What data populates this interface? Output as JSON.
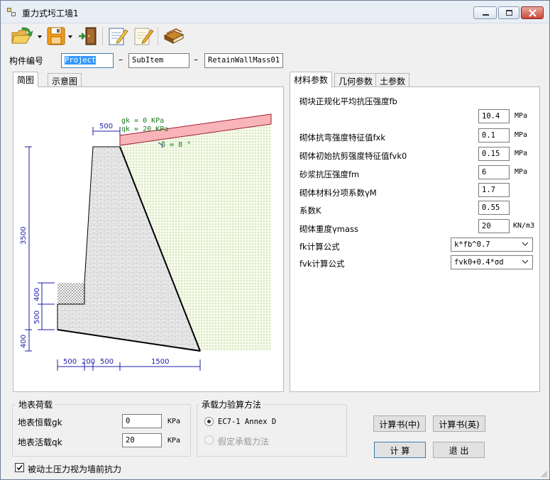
{
  "window": {
    "title": "重力式圬工墙1"
  },
  "toolbar": {
    "buttons": [
      {
        "name": "open-folder-icon"
      },
      {
        "name": "save-disk-icon"
      },
      {
        "name": "exit-door-icon"
      },
      {
        "name": "edit-note-icon"
      },
      {
        "name": "edit-pencil-icon"
      },
      {
        "name": "book-icon"
      }
    ]
  },
  "id_row": {
    "label": "构件编号",
    "project": "Project",
    "subitem": "SubItem",
    "name": "RetainWallMass01",
    "sep": "–"
  },
  "left_tabs": {
    "tabs": [
      "简图",
      "示意图"
    ],
    "active": 0
  },
  "diagram": {
    "dims": {
      "top_width": "500",
      "height_total": "3500",
      "toe_height": "400",
      "mid_height": "500",
      "base_height": "400",
      "base_widths": [
        "500",
        "200",
        "500",
        "1500"
      ]
    },
    "annotations": {
      "gk": "gk = 0 KPa",
      "qk": "qk = 20 KPa",
      "beta": "β = 8 °"
    },
    "colors": {
      "surcharge": "#f8b4b9",
      "backfill": "#d8e8b4",
      "wall": "#e8e8e8",
      "dimension": "#1c1ca8",
      "annotation": "#1c7a1c"
    }
  },
  "right_tabs": {
    "tabs": [
      "材料参数",
      "几何参数",
      "土参数"
    ],
    "active": 0
  },
  "material": {
    "rows": [
      {
        "label": "砌块正规化平均抗压强度fb",
        "value": "10.4",
        "unit": "MPa"
      },
      {
        "label": "砌体抗弯强度特征值fxk",
        "value": "0.1",
        "unit": "MPa"
      },
      {
        "label": "砌体初始抗剪强度特征值fvk0",
        "value": "0.15",
        "unit": "MPa"
      },
      {
        "label": "砂浆抗压强度fm",
        "value": "6",
        "unit": "MPa"
      },
      {
        "label": "砌体材料分项系数γM",
        "value": "1.7",
        "unit": ""
      },
      {
        "label": "系数K",
        "value": "0.55",
        "unit": ""
      },
      {
        "label": "砌体重度γmass",
        "value": "20",
        "unit": "KN/m3"
      }
    ],
    "formulas": [
      {
        "label": "fk计算公式",
        "value": "k*fb^0.7"
      },
      {
        "label": "fvk计算公式",
        "value": "fvk0+0.4*σd"
      }
    ]
  },
  "surface_load": {
    "title": "地表荷载",
    "dead_label": "地表恒载gk",
    "dead_value": "0",
    "live_label": "地表活载qk",
    "live_value": "20",
    "unit": "KPa"
  },
  "bearing": {
    "title": "承载力验算方法",
    "options": [
      {
        "label": "EC7-1 Annex D",
        "selected": true,
        "enabled": true
      },
      {
        "label": "假定承载力法",
        "selected": false,
        "enabled": false
      }
    ]
  },
  "buttons": {
    "report_cn": "计算书(中)",
    "report_en": "计算书(英)",
    "calculate": "计 算",
    "exit": "退 出"
  },
  "passive_checkbox": {
    "label": "被动土压力视为墙前抗力",
    "checked": true
  }
}
